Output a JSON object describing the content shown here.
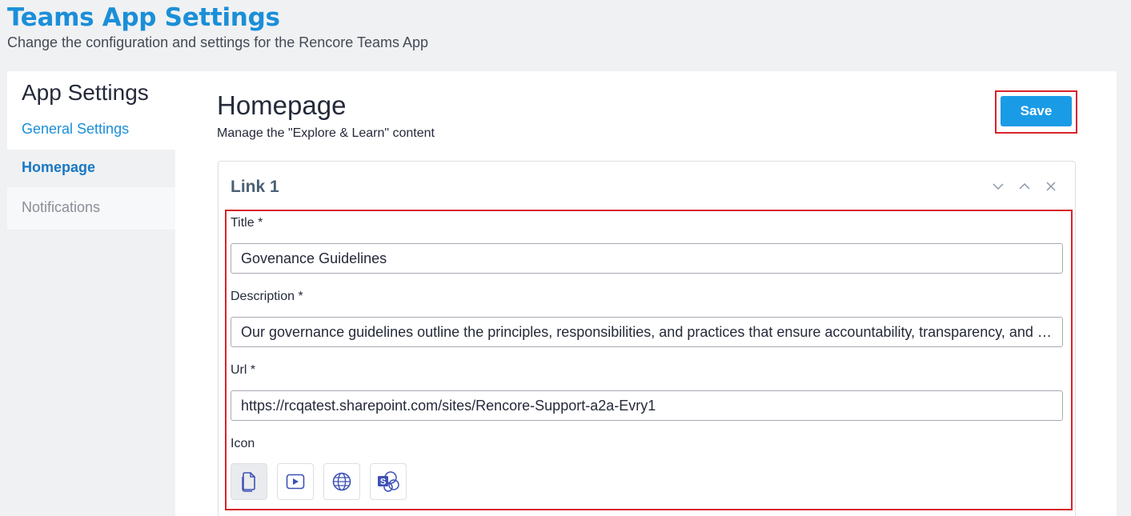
{
  "header": {
    "title": "Teams App Settings",
    "subtitle": "Change the configuration and settings for the Rencore Teams App"
  },
  "sidebar": {
    "title": "App Settings",
    "items": [
      {
        "label": "General Settings",
        "state": "link"
      },
      {
        "label": "Homepage",
        "state": "active"
      },
      {
        "label": "Notifications",
        "state": "muted"
      }
    ]
  },
  "main": {
    "title": "Homepage",
    "subtitle": "Manage the \"Explore & Learn\" content",
    "save_label": "Save"
  },
  "link_card": {
    "title": "Link 1",
    "controls": [
      "chevron-down-icon",
      "chevron-up-icon",
      "close-icon"
    ],
    "fields": {
      "title_label": "Title *",
      "title_value": "Govenance Guidelines",
      "description_label": "Description *",
      "description_value": "Our governance guidelines outline the principles, responsibilities, and practices that ensure accountability, transparency, and ethical conduct",
      "url_label": "Url *",
      "url_value": "https://rcqatest.sharepoint.com/sites/Rencore-Support-a2a-Evry1",
      "icon_label": "Icon"
    },
    "icon_options": [
      {
        "name": "document-icon",
        "selected": true
      },
      {
        "name": "video-icon",
        "selected": false
      },
      {
        "name": "globe-icon",
        "selected": false
      },
      {
        "name": "sharepoint-icon",
        "selected": false
      }
    ]
  },
  "colors": {
    "accent": "#1a8fd8",
    "save_button": "#1a9be6",
    "highlight_outline": "#d8232a",
    "icon_color": "#3f51b5"
  }
}
